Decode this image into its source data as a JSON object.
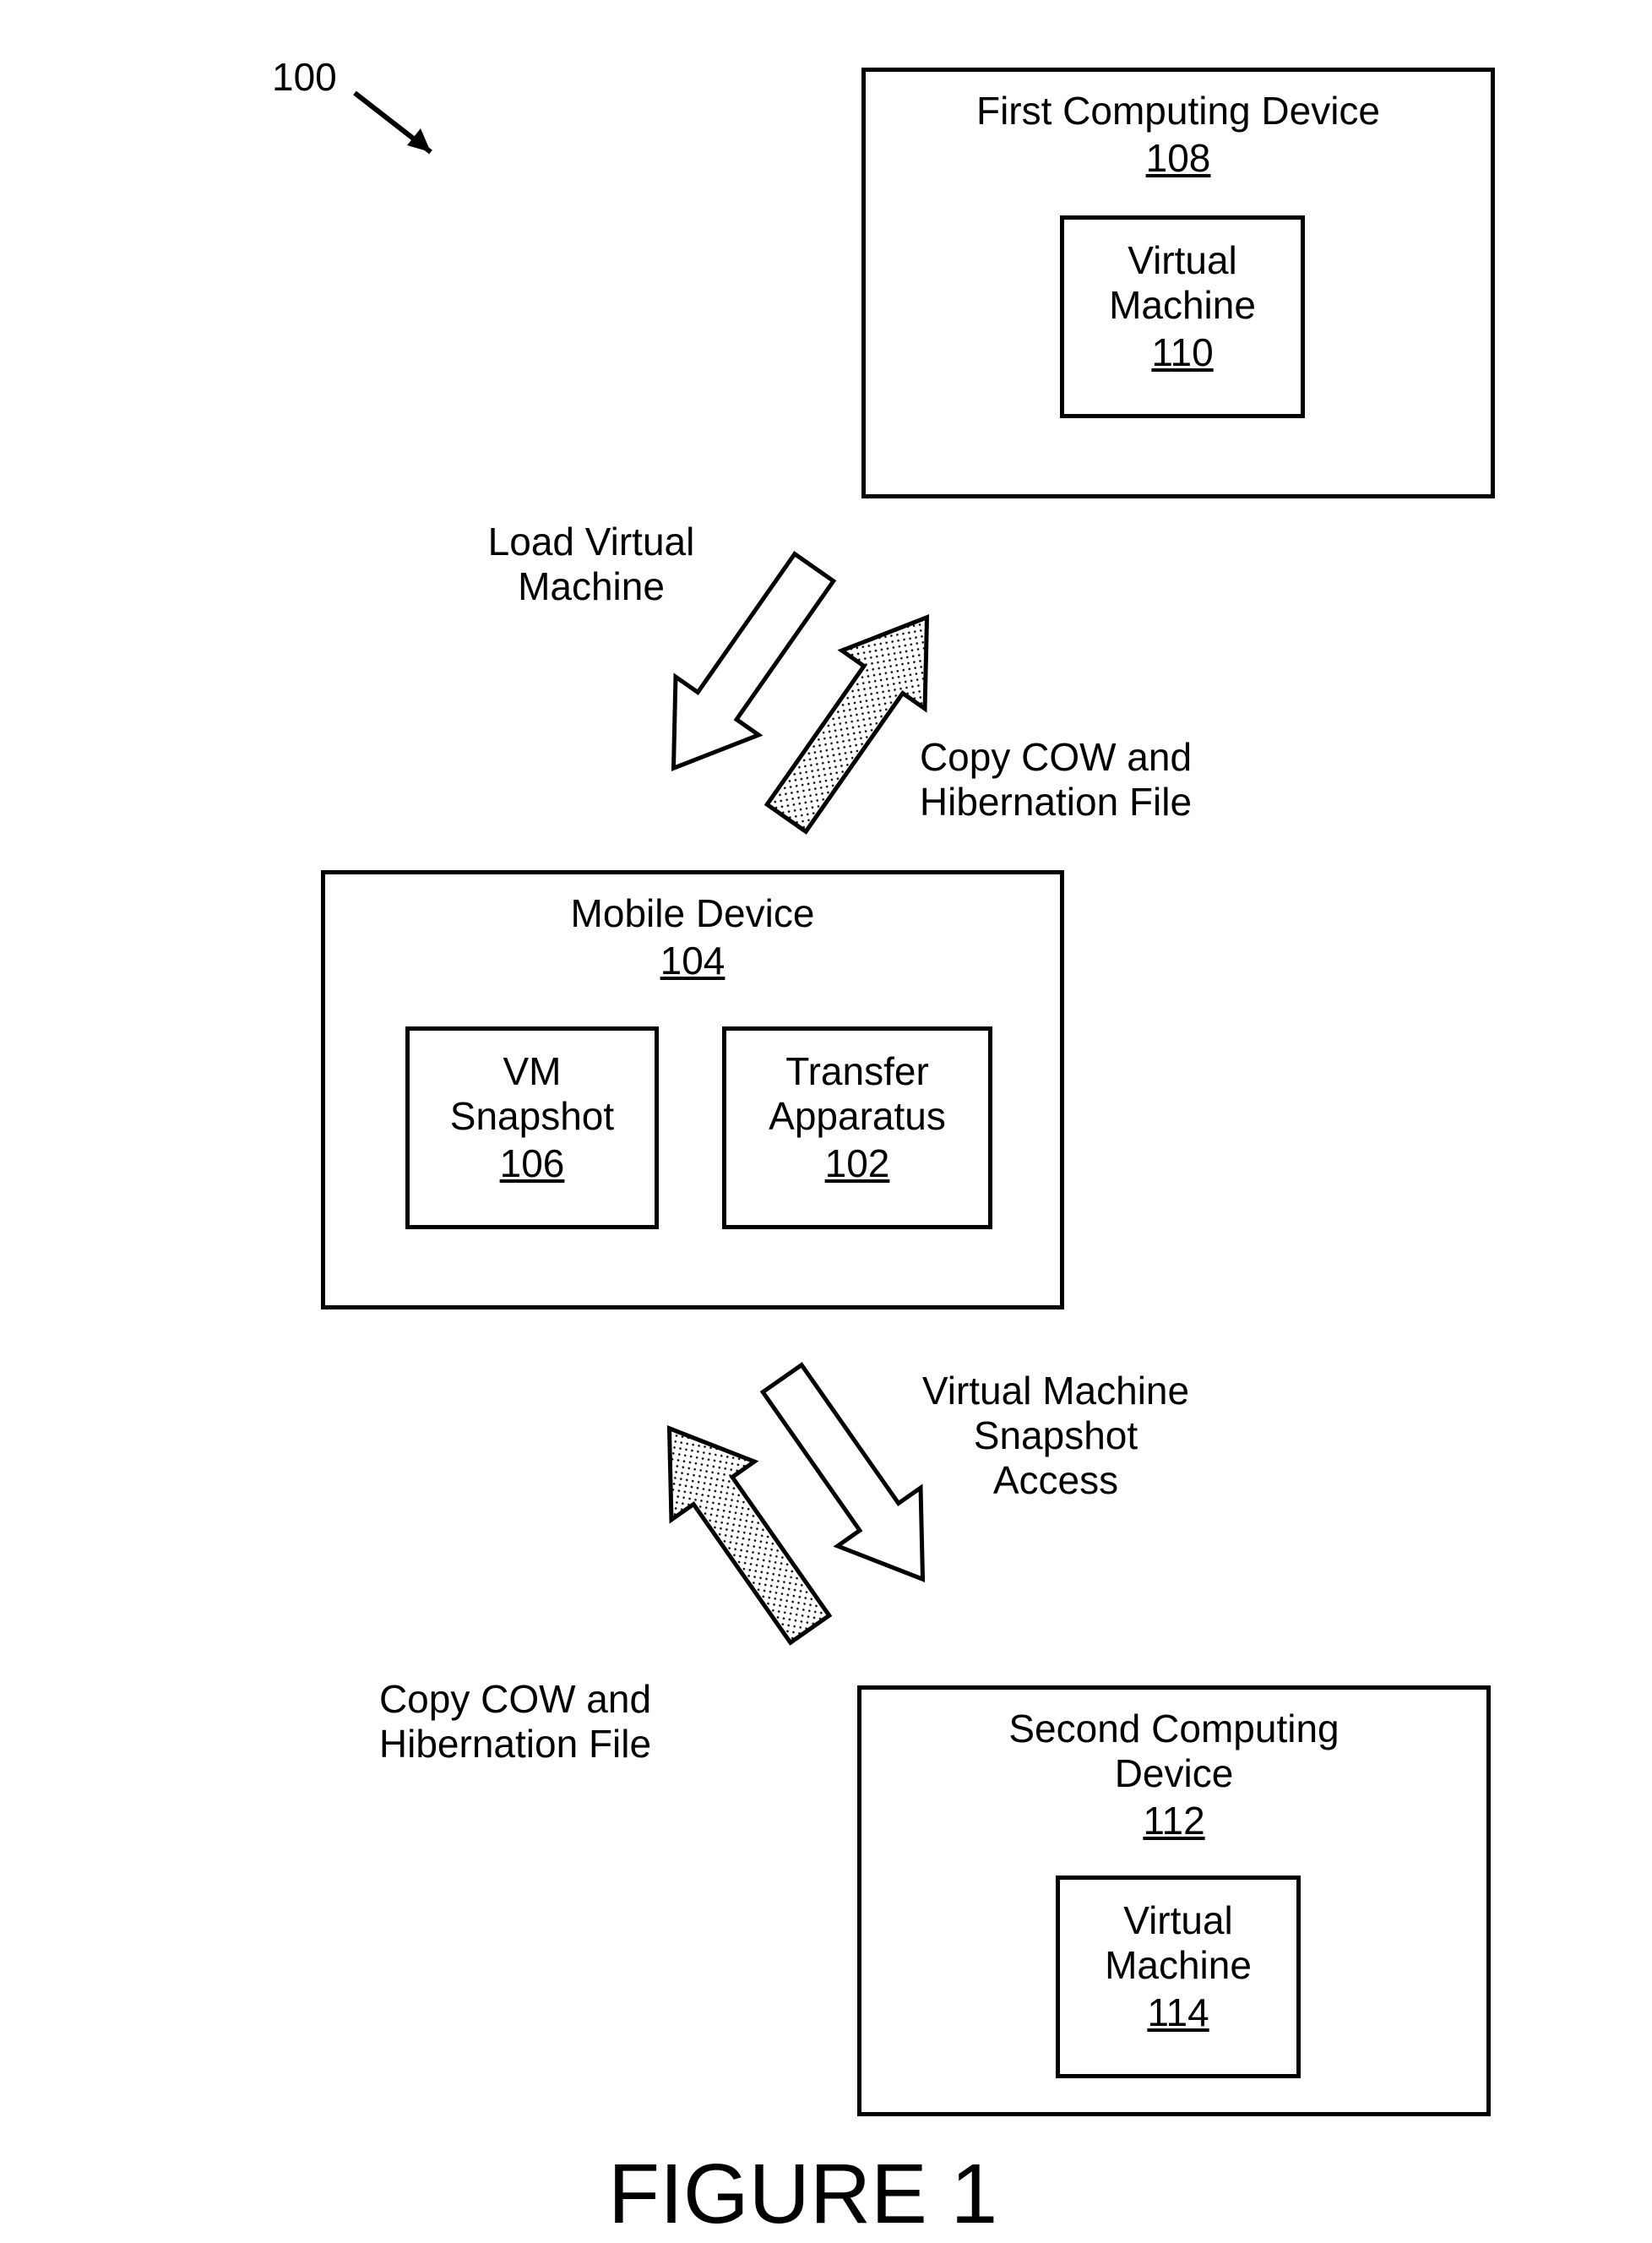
{
  "callout": {
    "num": "100"
  },
  "device1": {
    "title": "First Computing Device",
    "ref": "108",
    "vm_title": "Virtual\nMachine",
    "vm_ref": "110"
  },
  "mobile": {
    "title": "Mobile Device",
    "ref": "104",
    "snap_title": "VM\nSnapshot",
    "snap_ref": "106",
    "xfer_title": "Transfer\nApparatus",
    "xfer_ref": "102"
  },
  "device2": {
    "title": "Second Computing\nDevice",
    "ref": "112",
    "vm_title": "Virtual\nMachine",
    "vm_ref": "114"
  },
  "labels": {
    "load_vm": "Load Virtual\nMachine",
    "copy_cow_top": "Copy COW and\nHibernation File",
    "vm_snapshot_access": "Virtual Machine\nSnapshot\nAccess",
    "copy_cow_bottom": "Copy COW and\nHibernation File"
  },
  "figure": {
    "title": "FIGURE 1"
  }
}
